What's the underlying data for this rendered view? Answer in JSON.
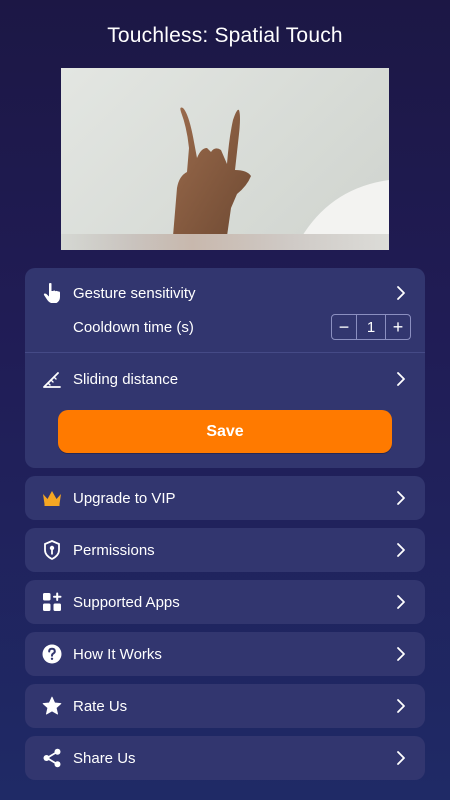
{
  "app": {
    "title": "Touchless: Spatial Touch"
  },
  "settings": {
    "gesture_sensitivity": "Gesture sensitivity",
    "cooldown_time": "Cooldown time (s)",
    "cooldown_value": "1",
    "minus": "−",
    "plus": "+",
    "sliding_distance": "Sliding distance",
    "save_label": "Save"
  },
  "menu": {
    "upgrade_vip": "Upgrade to VIP",
    "permissions": "Permissions",
    "supported_apps": "Supported Apps",
    "how_it_works": "How It Works",
    "rate_us": "Rate Us",
    "share_us": "Share Us"
  },
  "colors": {
    "background": "#1f1b4f",
    "card": "#32366f",
    "accent": "#ff7a00",
    "crown": "#f5a623"
  },
  "icons": {
    "gesture": "hand-pointer-icon",
    "sliding": "ruler-icon",
    "vip": "crown-icon",
    "permissions": "shield-key-icon",
    "apps": "apps-grid-icon",
    "how": "question-icon",
    "rate": "star-icon",
    "share": "share-icon",
    "chevron": "chevron-right-icon"
  }
}
